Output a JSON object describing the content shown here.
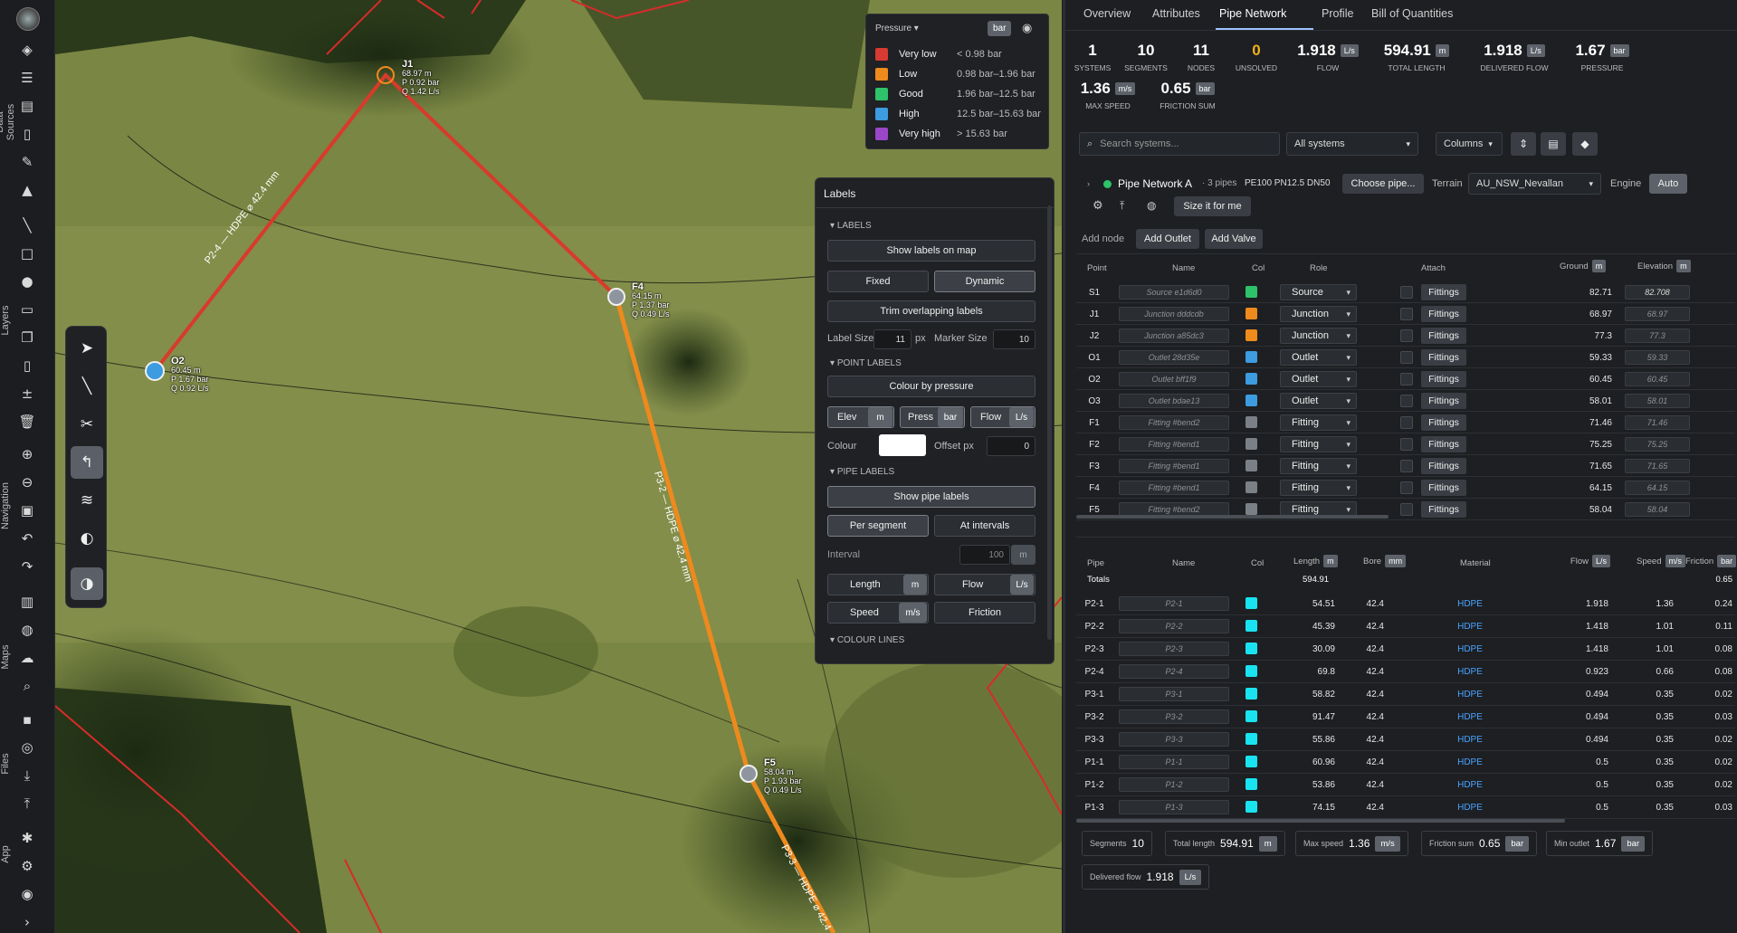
{
  "rail": {
    "sections": [
      "Data Sources",
      "Layers",
      "Navigation",
      "Maps",
      "Files",
      "App"
    ]
  },
  "map": {
    "nodes": [
      {
        "id": "J1",
        "elev": "68.97 m",
        "p": "P 0.92 bar",
        "q": "Q 1.42 L/s"
      },
      {
        "id": "F4",
        "elev": "64.15 m",
        "p": "P 1.37 bar",
        "q": "Q 0.49 L/s"
      },
      {
        "id": "O2",
        "elev": "60.45 m",
        "p": "P 1.67 bar",
        "q": "Q 0.92 L/s"
      },
      {
        "id": "F5",
        "elev": "58.04 m",
        "p": "P 1.93 bar",
        "q": "Q 0.49 L/s"
      }
    ],
    "pipe_labels": [
      "P2-4 — HDPE ⌀ 42.4 mm",
      "P3-2 — HDPE ⌀ 42.4 mm",
      "P3-3 — HDPE ⌀ 42.4"
    ]
  },
  "legend": {
    "title": "Pressure",
    "unit": "bar",
    "rows": [
      {
        "name": "Very low",
        "range": "< 0.98 bar",
        "color": "#d63a32"
      },
      {
        "name": "Low",
        "range": "0.98 bar–1.96 bar",
        "color": "#ef8a1d"
      },
      {
        "name": "Good",
        "range": "1.96 bar–12.5 bar",
        "color": "#2ec26a"
      },
      {
        "name": "High",
        "range": "12.5 bar–15.63 bar",
        "color": "#3d9be0"
      },
      {
        "name": "Very high",
        "range": "> 15.63 bar",
        "color": "#9a46c8"
      }
    ]
  },
  "labels_panel": {
    "title": "Labels",
    "sec_labels": "LABELS",
    "show_labels": "Show labels on map",
    "fixed": "Fixed",
    "dynamic": "Dynamic",
    "trim": "Trim overlapping labels",
    "label_size_label": "Label Size",
    "label_size": "11",
    "px": "px",
    "marker_size_label": "Marker Size",
    "marker_size": "10",
    "sec_point": "POINT LABELS",
    "colour_by_pressure": "Colour by pressure",
    "elev": "Elev",
    "elev_unit": "m",
    "press": "Press",
    "press_unit": "bar",
    "flow": "Flow",
    "flow_unit": "L/s",
    "colour_label": "Colour",
    "offset_label": "Offset px",
    "offset": "0",
    "sec_pipe": "PIPE LABELS",
    "show_pipe": "Show pipe labels",
    "per_segment": "Per segment",
    "at_intervals": "At intervals",
    "interval_label": "Interval",
    "interval": "100",
    "interval_unit": "m",
    "length": "Length",
    "length_unit": "m",
    "pflow": "Flow",
    "pflow_unit": "L/s",
    "speed": "Speed",
    "speed_unit": "m/s",
    "friction": "Friction",
    "sec_colour": "COLOUR LINES"
  },
  "tabs": [
    "Overview",
    "Attributes",
    "Pipe Network",
    "Profile",
    "Bill of Quantities"
  ],
  "stats": [
    {
      "v": "1",
      "u": "",
      "k": "SYSTEMS"
    },
    {
      "v": "10",
      "u": "",
      "k": "SEGMENTS"
    },
    {
      "v": "11",
      "u": "",
      "k": "NODES"
    },
    {
      "v": "0",
      "u": "",
      "k": "UNSOLVED"
    },
    {
      "v": "1.918",
      "u": "L/s",
      "k": "FLOW"
    },
    {
      "v": "594.91",
      "u": "m",
      "k": "TOTAL LENGTH"
    },
    {
      "v": "1.918",
      "u": "L/s",
      "k": "DELIVERED FLOW"
    },
    {
      "v": "1.67",
      "u": "bar",
      "k": "PRESSURE"
    },
    {
      "v": "1.36",
      "u": "m/s",
      "k": "MAX SPEED"
    },
    {
      "v": "0.65",
      "u": "bar",
      "k": "FRICTION SUM"
    }
  ],
  "toolbar": {
    "search_placeholder": "Search systems...",
    "systems_select": "All systems",
    "columns": "Columns"
  },
  "system": {
    "name": "Pipe Network A",
    "meta": "· 3 pipes",
    "spec": "PE100 PN12.5 DN50",
    "choose_pipe": "Choose pipe...",
    "terrain_label": "Terrain",
    "terrain": "AU_NSW_Nevallan",
    "engine_label": "Engine",
    "engine": "Auto",
    "size_it": "Size it for me",
    "add_node": "Add node",
    "add_outlet": "Add Outlet",
    "add_valve": "Add Valve"
  },
  "nodes_table": {
    "headers": {
      "point": "Point",
      "name": "Name",
      "col": "Col",
      "role": "Role",
      "attach": "Attach",
      "ground": "Ground",
      "ground_unit": "m",
      "elevation": "Elevation",
      "elevation_unit": "m"
    },
    "fittings_label": "Fittings",
    "rows": [
      {
        "point": "S1",
        "name": "Source e1d6d0",
        "color": "#2ec26a",
        "role": "Source",
        "ground": "82.71",
        "elev": "82.708"
      },
      {
        "point": "J1",
        "name": "Junction dddcdb",
        "color": "#ef8a1d",
        "role": "Junction",
        "ground": "68.97",
        "elev": "68.97"
      },
      {
        "point": "J2",
        "name": "Junction a85dc3",
        "color": "#ef8a1d",
        "role": "Junction",
        "ground": "77.3",
        "elev": "77.3"
      },
      {
        "point": "O1",
        "name": "Outlet 28d35e",
        "color": "#3d9be0",
        "role": "Outlet",
        "ground": "59.33",
        "elev": "59.33"
      },
      {
        "point": "O2",
        "name": "Outlet bff1f9",
        "color": "#3d9be0",
        "role": "Outlet",
        "ground": "60.45",
        "elev": "60.45"
      },
      {
        "point": "O3",
        "name": "Outlet bdae13",
        "color": "#3d9be0",
        "role": "Outlet",
        "ground": "58.01",
        "elev": "58.01"
      },
      {
        "point": "F1",
        "name": "Fitting #bend2",
        "color": "#7b8087",
        "role": "Fitting",
        "ground": "71.46",
        "elev": "71.46"
      },
      {
        "point": "F2",
        "name": "Fitting #bend1",
        "color": "#7b8087",
        "role": "Fitting",
        "ground": "75.25",
        "elev": "75.25"
      },
      {
        "point": "F3",
        "name": "Fitting #bend1",
        "color": "#7b8087",
        "role": "Fitting",
        "ground": "71.65",
        "elev": "71.65"
      },
      {
        "point": "F4",
        "name": "Fitting #bend1",
        "color": "#7b8087",
        "role": "Fitting",
        "ground": "64.15",
        "elev": "64.15"
      },
      {
        "point": "F5",
        "name": "Fitting #bend2",
        "color": "#7b8087",
        "role": "Fitting",
        "ground": "58.04",
        "elev": "58.04"
      }
    ]
  },
  "pipes_table": {
    "headers": {
      "pipe": "Pipe",
      "name": "Name",
      "col": "Col",
      "length": "Length",
      "length_unit": "m",
      "bore": "Bore",
      "bore_unit": "mm",
      "material": "Material",
      "flow": "Flow",
      "flow_unit": "L/s",
      "speed": "Speed",
      "speed_unit": "m/s",
      "friction": "Friction",
      "friction_unit": "bar"
    },
    "totals": {
      "label": "Totals",
      "length": "594.91",
      "friction": "0.65"
    },
    "pipe_color": "#19e3f0",
    "rows": [
      {
        "pipe": "P2-1",
        "length": "54.51",
        "bore": "42.4",
        "material": "HDPE",
        "flow": "1.918",
        "speed": "1.36",
        "friction": "0.24"
      },
      {
        "pipe": "P2-2",
        "length": "45.39",
        "bore": "42.4",
        "material": "HDPE",
        "flow": "1.418",
        "speed": "1.01",
        "friction": "0.11"
      },
      {
        "pipe": "P2-3",
        "length": "30.09",
        "bore": "42.4",
        "material": "HDPE",
        "flow": "1.418",
        "speed": "1.01",
        "friction": "0.08"
      },
      {
        "pipe": "P2-4",
        "length": "69.8",
        "bore": "42.4",
        "material": "HDPE",
        "flow": "0.923",
        "speed": "0.66",
        "friction": "0.08"
      },
      {
        "pipe": "P3-1",
        "length": "58.82",
        "bore": "42.4",
        "material": "HDPE",
        "flow": "0.494",
        "speed": "0.35",
        "friction": "0.02"
      },
      {
        "pipe": "P3-2",
        "length": "91.47",
        "bore": "42.4",
        "material": "HDPE",
        "flow": "0.494",
        "speed": "0.35",
        "friction": "0.03"
      },
      {
        "pipe": "P3-3",
        "length": "55.86",
        "bore": "42.4",
        "material": "HDPE",
        "flow": "0.494",
        "speed": "0.35",
        "friction": "0.02"
      },
      {
        "pipe": "P1-1",
        "length": "60.96",
        "bore": "42.4",
        "material": "HDPE",
        "flow": "0.5",
        "speed": "0.35",
        "friction": "0.02"
      },
      {
        "pipe": "P1-2",
        "length": "53.86",
        "bore": "42.4",
        "material": "HDPE",
        "flow": "0.5",
        "speed": "0.35",
        "friction": "0.02"
      },
      {
        "pipe": "P1-3",
        "length": "74.15",
        "bore": "42.4",
        "material": "HDPE",
        "flow": "0.5",
        "speed": "0.35",
        "friction": "0.03"
      }
    ]
  },
  "summary": [
    {
      "k": "Segments",
      "v": "10",
      "u": ""
    },
    {
      "k": "Total length",
      "v": "594.91",
      "u": "m"
    },
    {
      "k": "Max speed",
      "v": "1.36",
      "u": "m/s"
    },
    {
      "k": "Friction sum",
      "v": "0.65",
      "u": "bar"
    },
    {
      "k": "Min outlet",
      "v": "1.67",
      "u": "bar"
    },
    {
      "k": "Delivered flow",
      "v": "1.918",
      "u": "L/s"
    }
  ]
}
